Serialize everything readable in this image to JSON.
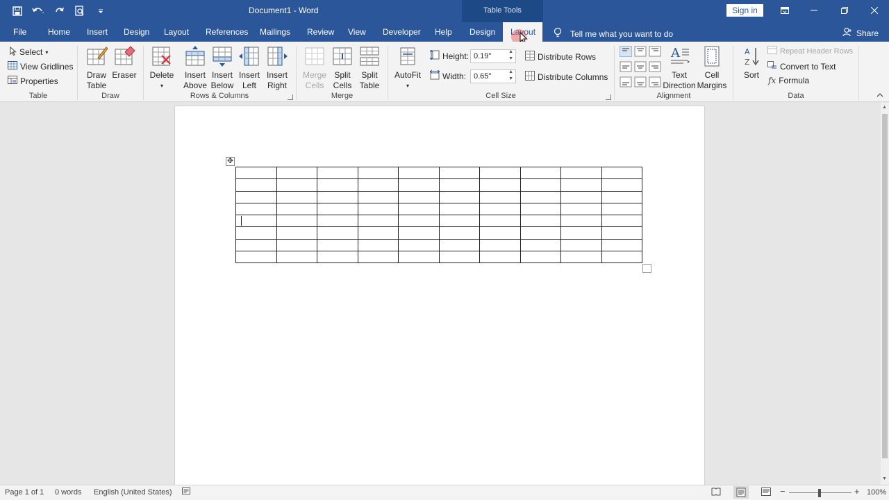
{
  "app": {
    "title": "Document1  -  Word",
    "context_title": "Table Tools",
    "sign_in": "Sign in"
  },
  "tabs": [
    "File",
    "Home",
    "Insert",
    "Design",
    "Layout",
    "References",
    "Mailings",
    "Review",
    "View",
    "Developer",
    "Help",
    "Design",
    "Layout"
  ],
  "active_tab": "Layout",
  "tell_me": "Tell me what you want to do",
  "share": "Share",
  "ribbon": {
    "table_group": {
      "label": "Table",
      "select": "Select",
      "view_gridlines": "View Gridlines",
      "properties": "Properties"
    },
    "draw_group": {
      "label": "Draw",
      "draw_table_1": "Draw",
      "draw_table_2": "Table",
      "eraser": "Eraser"
    },
    "rows_columns_group": {
      "label": "Rows & Columns",
      "delete": "Delete",
      "insert_above_1": "Insert",
      "insert_above_2": "Above",
      "insert_below_1": "Insert",
      "insert_below_2": "Below",
      "insert_left_1": "Insert",
      "insert_left_2": "Left",
      "insert_right_1": "Insert",
      "insert_right_2": "Right"
    },
    "merge_group": {
      "label": "Merge",
      "merge_cells_1": "Merge",
      "merge_cells_2": "Cells",
      "split_cells_1": "Split",
      "split_cells_2": "Cells",
      "split_table_1": "Split",
      "split_table_2": "Table"
    },
    "cell_size_group": {
      "label": "Cell Size",
      "autofit": "AutoFit",
      "height_label": "Height:",
      "height_value": "0.19\"",
      "width_label": "Width:",
      "width_value": "0.65\"",
      "distribute_rows": "Distribute Rows",
      "distribute_columns": "Distribute Columns"
    },
    "alignment_group": {
      "label": "Alignment",
      "text_direction_1": "Text",
      "text_direction_2": "Direction",
      "cell_margins_1": "Cell",
      "cell_margins_2": "Margins"
    },
    "data_group": {
      "label": "Data",
      "sort": "Sort",
      "repeat_header_rows": "Repeat Header Rows",
      "convert_to_text": "Convert to Text",
      "formula": "Formula"
    }
  },
  "table": {
    "rows": 8,
    "cols": 10
  },
  "status": {
    "page": "Page 1 of 1",
    "words": "0 words",
    "language": "English (United States)",
    "zoom": "100%"
  },
  "colors": {
    "accent": "#2b579a",
    "ribbon": "#f3f3f3"
  }
}
